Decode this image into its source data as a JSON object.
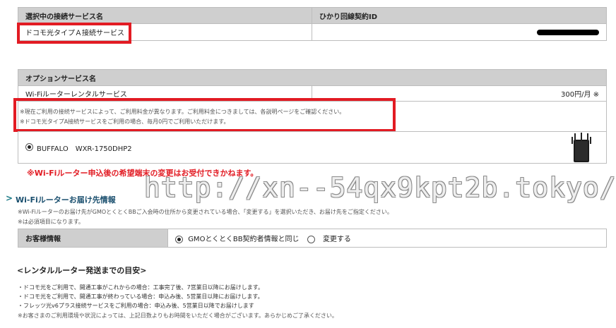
{
  "top_table": {
    "col1_header": "選択中の接続サービス名",
    "col2_header": "ひかり回線契約ID",
    "service_name": "ドコモ光タイプＡ接続サービス",
    "contract_id": ""
  },
  "option_table": {
    "header": "オプションサービス名",
    "service_name": "Wi-Fiルーターレンタルサービス",
    "price": "300円/月 ※"
  },
  "notes": {
    "note1": "※現在ご利用の接続サービスによって、ご利用料金が異なります。ご利用料金につきましては、各説明ページをご確認ください。",
    "note2": "※ドコモ光タイプA接続サービスをご利用の場合、毎月0円でご利用いただけます。"
  },
  "router_option": {
    "label": "BUFFALO　WXR-1750DHP2"
  },
  "router_warning": "※Wi-Fiルーター申込後の希望端末の変更はお受付できかねます。",
  "delivery": {
    "arrow": ">",
    "title": "Wi-Fiルーターお届け先情報",
    "note1": "※Wi-Fiルーターのお届け先がGMOとくとくBBご入会時の住所から変更されている場合、「変更する」を選択いただき、お届け先をご指定ください。",
    "note2": "※は必須項目になります。",
    "customer_label": "お客様情報",
    "option_same": "GMOとくとくBB契約者情報と同じ",
    "option_change": "変更する"
  },
  "schedule": {
    "title": "<レンタルルーター発送までの目安>",
    "items": [
      "・ドコモ光をご利用で、開通工事がこれからの場合：工事完了後、7営業日以降にお届けします。",
      "・ドコモ光をご利用で、開通工事が終わっている場合：申込み後、5営業日以降にお届けします。",
      "・フレッツ光v6プラス接続サービスをご利用の場合：申込み後、5営業日以降でお届けします"
    ],
    "warning": "※お客さまのご利用環境や状況によっては、上記日数よりもお時間をいただく場合がございます。あらかじめご了承ください。"
  },
  "watermark": "http://xn--54qx9kpt2b.tokyo/",
  "colors": {
    "accent_red": "#e21b23",
    "header_gray": "#cfcfcf",
    "teal": "#1a7a86"
  }
}
